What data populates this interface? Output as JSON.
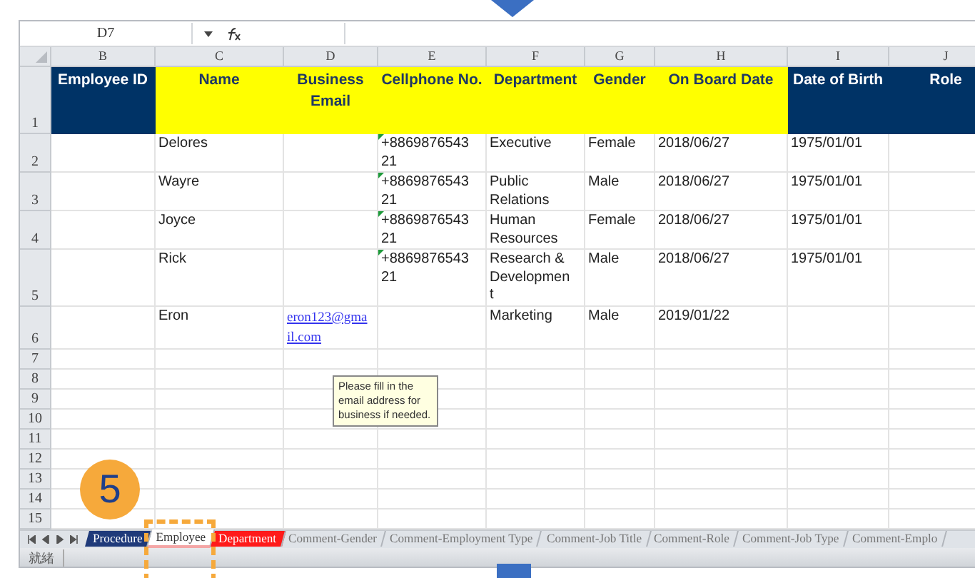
{
  "name_box": "D7",
  "columns": [
    {
      "letter": "B"
    },
    {
      "letter": "C"
    },
    {
      "letter": "D",
      "kind": "link"
    },
    {
      "letter": "E",
      "kind": "number_text"
    },
    {
      "letter": "F"
    },
    {
      "letter": "G"
    },
    {
      "letter": "H"
    },
    {
      "letter": "I"
    },
    {
      "letter": "J"
    }
  ],
  "header_row": {
    "number": "1",
    "cells": [
      {
        "text": "Employee ID",
        "color": "#003366"
      },
      {
        "text": "Name",
        "color": "#ffff00"
      },
      {
        "text": "Business\nEmail",
        "color": "#ffff00"
      },
      {
        "text": "Cellphone No.",
        "color": "#ffff00"
      },
      {
        "text": "Department",
        "color": "#ffff00"
      },
      {
        "text": "Gender",
        "color": "#ffff00"
      },
      {
        "text": "On Board Date",
        "color": "#ffff00"
      },
      {
        "text": "Date of Birth",
        "color": "#003366"
      },
      {
        "text": "Role",
        "color": "#003366"
      }
    ]
  },
  "rows": [
    {
      "number": "2",
      "cells": {
        "C": "Delores",
        "E": "+8869876543\n21",
        "F": "Executive",
        "G": "Female",
        "H": "2018/06/27",
        "I": "1975/01/01"
      }
    },
    {
      "number": "3",
      "cells": {
        "C": "Wayre",
        "E": "+8869876543\n21",
        "F": "Public\nRelations",
        "G": "Male",
        "H": "2018/06/27",
        "I": "1975/01/01"
      }
    },
    {
      "number": "4",
      "cells": {
        "C": "Joyce",
        "E": "+8869876543\n21",
        "F": "Human\nResources",
        "G": "Female",
        "H": "2018/06/27",
        "I": "1975/01/01"
      }
    },
    {
      "number": "5",
      "cells": {
        "C": "Rick",
        "E": "+8869876543\n21",
        "F": "Research &\nDevelopmen\nt",
        "G": "Male",
        "H": "2018/06/27",
        "I": "1975/01/01"
      }
    },
    {
      "number": "6",
      "cells": {
        "C": "Eron",
        "D": "eron123@gma\nil.com",
        "F": "Marketing",
        "G": "Male",
        "H": "2019/01/22"
      }
    },
    {
      "number": "7"
    },
    {
      "number": "8"
    },
    {
      "number": "9"
    },
    {
      "number": "10"
    },
    {
      "number": "11"
    },
    {
      "number": "12"
    },
    {
      "number": "13"
    },
    {
      "number": "14"
    },
    {
      "number": "15"
    }
  ],
  "comment": "Please fill in the email address for business if needed.",
  "sheet_tabs": [
    {
      "label": "Procedure",
      "selected": false,
      "color": "#1f3a7a"
    },
    {
      "label": "Employee",
      "selected": true
    },
    {
      "label": "Department",
      "selected": false,
      "color": "#ff1a1a"
    },
    {
      "label": "Comment-Gender",
      "selected": false
    },
    {
      "label": "Comment-Employment Type",
      "selected": false
    },
    {
      "label": "Comment-Job Title",
      "selected": false
    },
    {
      "label": "Comment-Role",
      "selected": false
    },
    {
      "label": "Comment-Job Type",
      "selected": false
    },
    {
      "label": "Comment-Emplo",
      "selected": false
    }
  ],
  "status_bar": {
    "text": "就緒"
  },
  "step_badge": "5"
}
